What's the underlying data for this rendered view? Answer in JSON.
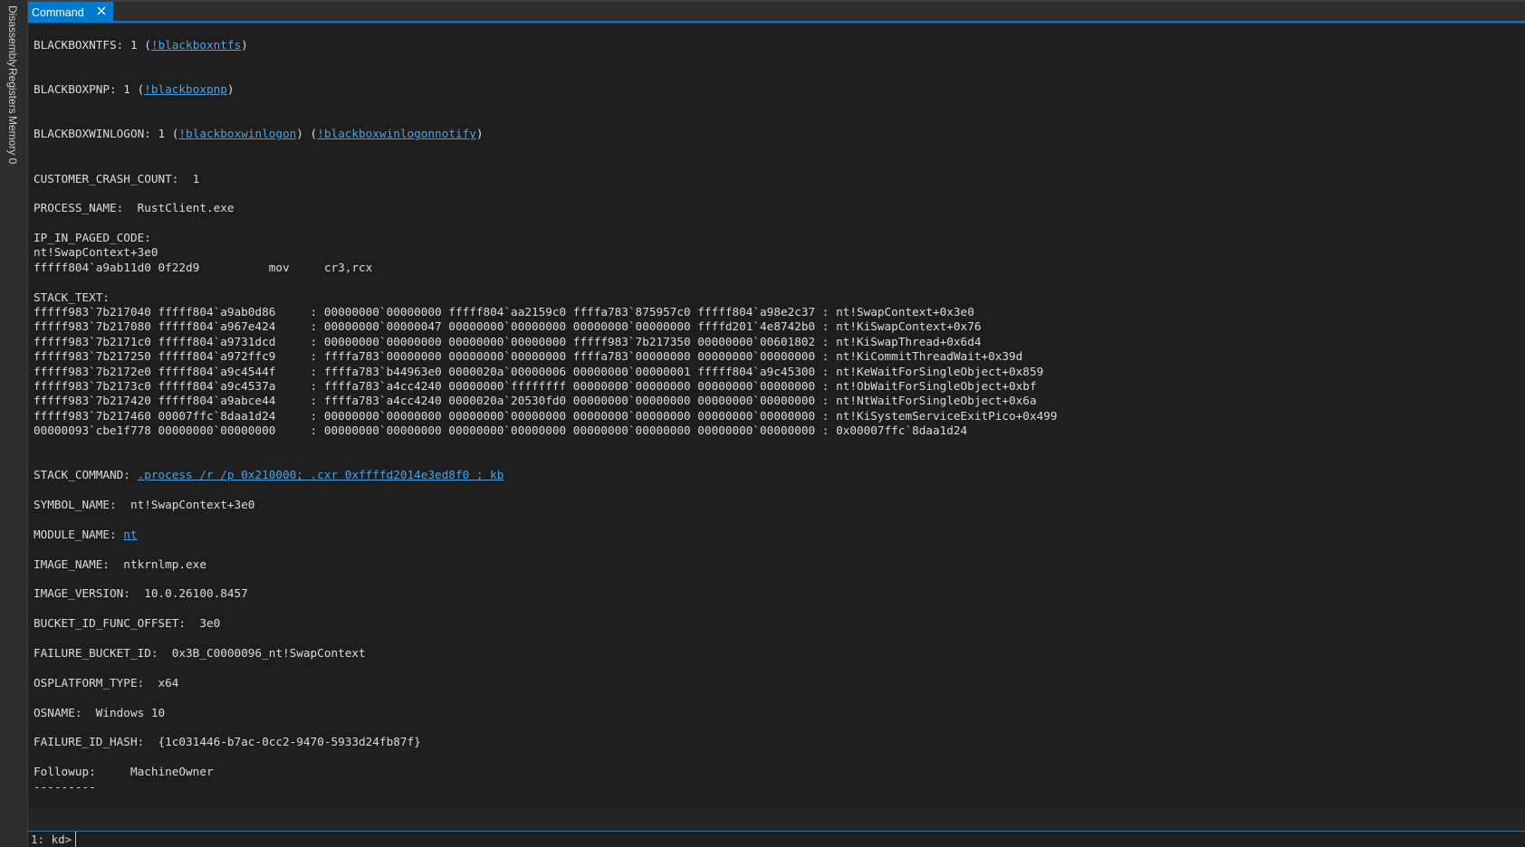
{
  "sidebar": {
    "tabs": [
      {
        "label": "Disassembly"
      },
      {
        "label": "Registers"
      },
      {
        "label": "Memory 0"
      }
    ]
  },
  "tab": {
    "label": "Command"
  },
  "output": [
    {
      "parts": [
        {
          "t": "BLACKBOXNTFS: 1 ("
        },
        {
          "t": "!blackboxntfs",
          "link": true
        },
        {
          "t": ")"
        }
      ]
    },
    {
      "parts": []
    },
    {
      "parts": []
    },
    {
      "parts": [
        {
          "t": "BLACKBOXPNP: 1 ("
        },
        {
          "t": "!blackboxpnp",
          "link": true
        },
        {
          "t": ")"
        }
      ]
    },
    {
      "parts": []
    },
    {
      "parts": []
    },
    {
      "parts": [
        {
          "t": "BLACKBOXWINLOGON: 1 ("
        },
        {
          "t": "!blackboxwinlogon",
          "link": true
        },
        {
          "t": ") ("
        },
        {
          "t": "!blackboxwinlogonnotify",
          "link": true
        },
        {
          "t": ")"
        }
      ]
    },
    {
      "parts": []
    },
    {
      "parts": []
    },
    {
      "parts": [
        {
          "t": "CUSTOMER_CRASH_COUNT:  1"
        }
      ]
    },
    {
      "parts": []
    },
    {
      "parts": [
        {
          "t": "PROCESS_NAME:  RustClient.exe"
        }
      ]
    },
    {
      "parts": []
    },
    {
      "parts": [
        {
          "t": "IP_IN_PAGED_CODE:"
        }
      ]
    },
    {
      "parts": [
        {
          "t": "nt!SwapContext+3e0"
        }
      ]
    },
    {
      "parts": [
        {
          "t": "fffff804`a9ab11d0 0f22d9          mov     cr3,rcx"
        }
      ]
    },
    {
      "parts": []
    },
    {
      "parts": [
        {
          "t": "STACK_TEXT:"
        }
      ]
    },
    {
      "parts": [
        {
          "t": "fffff983`7b217040 fffff804`a9ab0d86     : 00000000`00000000 fffff804`aa2159c0 ffffa783`875957c0 fffff804`a98e2c37 : nt!SwapContext+0x3e0"
        }
      ]
    },
    {
      "parts": [
        {
          "t": "fffff983`7b217080 fffff804`a967e424     : 00000000`00000047 00000000`00000000 00000000`00000000 ffffd201`4e8742b0 : nt!KiSwapContext+0x76"
        }
      ]
    },
    {
      "parts": [
        {
          "t": "fffff983`7b2171c0 fffff804`a9731dcd     : 00000000`00000000 00000000`00000000 fffff983`7b217350 00000000`00601802 : nt!KiSwapThread+0x6d4"
        }
      ]
    },
    {
      "parts": [
        {
          "t": "fffff983`7b217250 fffff804`a972ffc9     : ffffa783`00000000 00000000`00000000 ffffa783`00000000 00000000`00000000 : nt!KiCommitThreadWait+0x39d"
        }
      ]
    },
    {
      "parts": [
        {
          "t": "fffff983`7b2172e0 fffff804`a9c4544f     : ffffa783`b44963e0 0000020a`00000006 00000000`00000001 fffff804`a9c45300 : nt!KeWaitForSingleObject+0x859"
        }
      ]
    },
    {
      "parts": [
        {
          "t": "fffff983`7b2173c0 fffff804`a9c4537a     : ffffa783`a4cc4240 00000000`ffffffff 00000000`00000000 00000000`00000000 : nt!ObWaitForSingleObject+0xbf"
        }
      ]
    },
    {
      "parts": [
        {
          "t": "fffff983`7b217420 fffff804`a9abce44     : ffffa783`a4cc4240 0000020a`20530fd0 00000000`00000000 00000000`00000000 : nt!NtWaitForSingleObject+0x6a"
        }
      ]
    },
    {
      "parts": [
        {
          "t": "fffff983`7b217460 00007ffc`8daa1d24     : 00000000`00000000 00000000`00000000 00000000`00000000 00000000`00000000 : nt!KiSystemServiceExitPico+0x499"
        }
      ]
    },
    {
      "parts": [
        {
          "t": "00000093`cbe1f778 00000000`00000000     : 00000000`00000000 00000000`00000000 00000000`00000000 00000000`00000000 : 0x00007ffc`8daa1d24"
        }
      ]
    },
    {
      "parts": []
    },
    {
      "parts": []
    },
    {
      "parts": [
        {
          "t": "STACK_COMMAND: "
        },
        {
          "t": ".process /r /p 0x210000; .cxr 0xffffd2014e3ed8f0 ; kb",
          "link": true
        }
      ]
    },
    {
      "parts": []
    },
    {
      "parts": [
        {
          "t": "SYMBOL_NAME:  nt!SwapContext+3e0"
        }
      ]
    },
    {
      "parts": []
    },
    {
      "parts": [
        {
          "t": "MODULE_NAME: "
        },
        {
          "t": "nt",
          "link": true
        }
      ]
    },
    {
      "parts": []
    },
    {
      "parts": [
        {
          "t": "IMAGE_NAME:  ntkrnlmp.exe"
        }
      ]
    },
    {
      "parts": []
    },
    {
      "parts": [
        {
          "t": "IMAGE_VERSION:  10.0.26100.8457"
        }
      ]
    },
    {
      "parts": []
    },
    {
      "parts": [
        {
          "t": "BUCKET_ID_FUNC_OFFSET:  3e0"
        }
      ]
    },
    {
      "parts": []
    },
    {
      "parts": [
        {
          "t": "FAILURE_BUCKET_ID:  0x3B_C0000096_nt!SwapContext"
        }
      ]
    },
    {
      "parts": []
    },
    {
      "parts": [
        {
          "t": "OSPLATFORM_TYPE:  x64"
        }
      ]
    },
    {
      "parts": []
    },
    {
      "parts": [
        {
          "t": "OSNAME:  Windows 10"
        }
      ]
    },
    {
      "parts": []
    },
    {
      "parts": [
        {
          "t": "FAILURE_ID_HASH:  {1c031446-b7ac-0cc2-9470-5933d24fb87f}"
        }
      ]
    },
    {
      "parts": []
    },
    {
      "parts": [
        {
          "t": "Followup:     MachineOwner"
        }
      ]
    },
    {
      "parts": [
        {
          "t": "---------"
        }
      ]
    }
  ],
  "command": {
    "prompt": "1: kd>",
    "value": ""
  },
  "colors": {
    "accent": "#007acc",
    "link": "#4aa3e8",
    "text": "#dcdcdc",
    "background": "#1e1e1e"
  }
}
